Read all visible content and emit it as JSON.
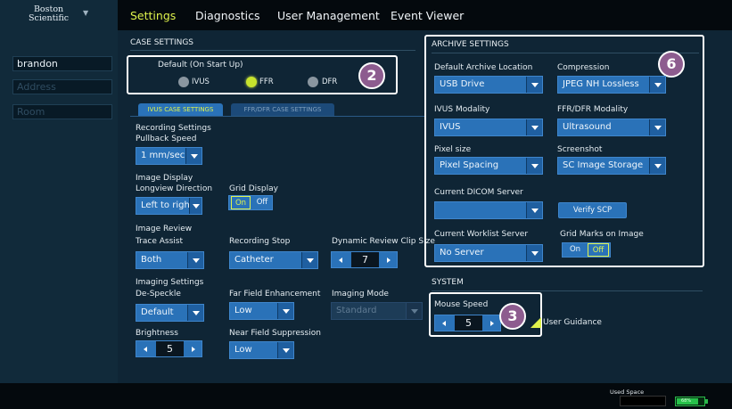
{
  "brand": {
    "logo_line1": "Boston",
    "logo_line2": "Scientific"
  },
  "nav": {
    "settings": "Settings",
    "diagnostics": "Diagnostics",
    "user_management": "User Management",
    "event_viewer": "Event Viewer"
  },
  "sidebar": {
    "user": "brandon",
    "address_placeholder": "Address",
    "room_placeholder": "Room"
  },
  "case_settings": {
    "title": "CASE SETTINGS",
    "default_label": "Default (On Start Up)",
    "modes": [
      "IVUS",
      "FFR",
      "DFR"
    ],
    "selected_mode": "FFR",
    "tabs": [
      "IVUS CASE SETTINGS",
      "FFR/DFR CASE SETTINGS"
    ],
    "recording_settings": "Recording Settings",
    "pullback_speed_label": "Pullback Speed",
    "pullback_speed_value": "1 mm/sec",
    "image_display": "Image Display",
    "longview_label": "Longview Direction",
    "longview_value": "Left to right",
    "grid_display_label": "Grid Display",
    "grid_on": "On",
    "grid_off": "Off",
    "grid_selected": "On",
    "image_review": "Image Review",
    "trace_assist_label": "Trace Assist",
    "trace_assist_value": "Both",
    "recording_stop_label": "Recording Stop",
    "recording_stop_value": "Catheter",
    "dynamic_review_label": "Dynamic Review Clip Size",
    "dynamic_review_value": "7",
    "imaging_settings": "Imaging Settings",
    "despeckle_label": "De-Speckle",
    "despeckle_value": "Default",
    "far_field_label": "Far Field Enhancement",
    "far_field_value": "Low",
    "imaging_mode_label": "Imaging Mode",
    "imaging_mode_value": "Standard",
    "brightness_label": "Brightness",
    "brightness_value": "5",
    "near_field_label": "Near Field Suppression",
    "near_field_value": "Low"
  },
  "archive": {
    "title": "ARCHIVE SETTINGS",
    "default_location_label": "Default Archive Location",
    "default_location_value": "USB Drive",
    "compression_label": "Compression",
    "compression_value": "JPEG NH Lossless",
    "ivus_modality_label": "IVUS Modality",
    "ivus_modality_value": "IVUS",
    "ffr_modality_label": "FFR/DFR Modality",
    "ffr_modality_value": "Ultrasound",
    "pixel_size_label": "Pixel size",
    "pixel_size_value": "Pixel Spacing",
    "screenshot_label": "Screenshot",
    "screenshot_value": "SC Image Storage",
    "dicom_server_label": "Current DICOM Server",
    "dicom_server_value": "",
    "verify_scp": "Verify SCP",
    "worklist_label": "Current Worklist Server",
    "worklist_value": "No Server",
    "grid_marks_label": "Grid Marks on Image",
    "grid_marks_on": "On",
    "grid_marks_off": "Off",
    "grid_marks_selected": "Off"
  },
  "system": {
    "title": "SYSTEM",
    "mouse_speed_label": "Mouse Speed",
    "mouse_speed_value": "5",
    "user_guidance_label": "User Guidance"
  },
  "callouts": {
    "a": "2",
    "b": "6",
    "c": "3"
  },
  "status": {
    "used_space_label": "Used Space",
    "battery_text": "68%",
    "battery_level": 0.68
  },
  "colors": {
    "accent": "#dff24c",
    "control_blue": "#2a72b8",
    "background": "#0f2535",
    "callout": "#8d5c8f"
  }
}
